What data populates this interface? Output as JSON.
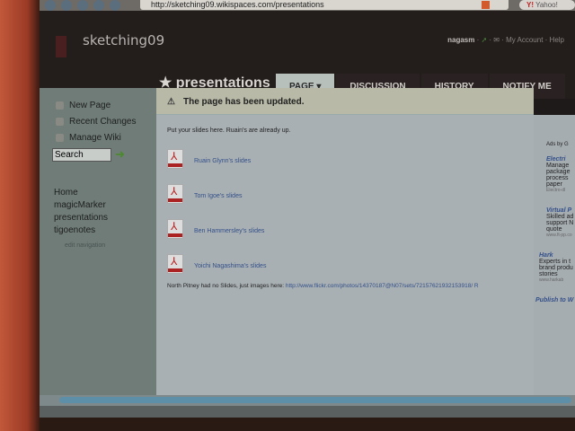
{
  "browser": {
    "url": "http://sketching09.wikispaces.com/presentations",
    "search_engine": "Yahoo!"
  },
  "header": {
    "site_name": "sketching09",
    "user": "nagasm",
    "links": [
      "My Account",
      "Help"
    ]
  },
  "page": {
    "title": "presentations",
    "tabs": [
      {
        "label": "PAGE ▾",
        "active": true
      },
      {
        "label": "DISCUSSION"
      },
      {
        "label": "HISTORY"
      },
      {
        "label": "NOTIFY ME"
      }
    ]
  },
  "sidebar": {
    "actions": [
      "New Page",
      "Recent Changes",
      "Manage Wiki"
    ],
    "search_value": "Search",
    "nav": [
      "Home",
      "magicMarker",
      "presentations",
      "tigoenotes"
    ],
    "edit_nav": "edit navigation"
  },
  "notice": "The page has been updated.",
  "content": {
    "intro": "Put your slides here. Ruain's are already up.",
    "files": [
      "Ruain Glynn's slides",
      "Tom Igoe's slides",
      "Ben Hammersley's slides",
      "Yoichi Nagashima's slides"
    ],
    "footer_text": "North Pitney had no Slides, just images here:",
    "footer_link": "http://www.flickr.com/photos/14370187@N07/sets/72157621932153918/ R"
  },
  "ads": {
    "label": "Ads by G",
    "items": [
      {
        "title": "Electri",
        "body": [
          "Manage",
          "package",
          "process",
          "paper"
        ],
        "url": "Electro-dl"
      },
      {
        "title": "Virtual P",
        "body": [
          "Skilled ad",
          "support N",
          "quote"
        ],
        "url": "www.ft-pp.co"
      },
      {
        "title": "Hark",
        "body": [
          "Experts in t",
          "brand produ",
          "stories"
        ],
        "url": "www.harkab"
      }
    ],
    "publish": "Publish to W"
  }
}
